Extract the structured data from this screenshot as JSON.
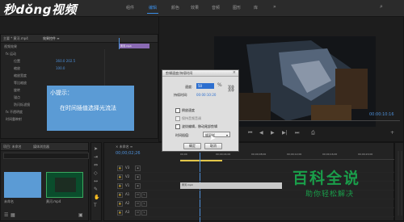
{
  "brand": {
    "text_left": "秒dǒng视频"
  },
  "top_tabs": [
    "组件",
    "编辑",
    "颜色",
    "效果",
    "音频",
    "图形",
    "库"
  ],
  "source_panel": {
    "tabs": [
      "主要 * 黄河.mp4",
      "效果控件 ≡",
      "源 * 黄河.mp4"
    ],
    "clip_name": "黄河.mp4",
    "rows": [
      {
        "label": "视频效果"
      },
      {
        "label": "fx 运动"
      },
      {
        "label": "位置",
        "value": "360.0  202.5"
      },
      {
        "label": "缩放",
        "value": "100.0"
      },
      {
        "label": "缩放宽度"
      },
      {
        "label": "等比缩放"
      },
      {
        "label": "旋转",
        "value": "0.0"
      },
      {
        "label": "锚点"
      },
      {
        "label": "防闪烁滤镜"
      },
      {
        "label": "fx 不透明度"
      },
      {
        "label": "时间重映射"
      }
    ]
  },
  "tip": {
    "title": "小提示：",
    "body": "在时间插值选择光流法"
  },
  "project": {
    "header": "项目: 未命名",
    "tab": "媒体浏览器",
    "search_hint": "",
    "items": [
      {
        "name": "未命名"
      },
      {
        "name": "黄河.mp4"
      }
    ]
  },
  "dialog": {
    "title": "剪辑速度/持续时间",
    "speed_label": "速度:",
    "speed_value": "50",
    "duration_label": "持续时间:",
    "duration_value": "00:00:10:20",
    "checks": [
      "倒放速度",
      "保持音频音调",
      "波纹编辑，移动尾部剪辑"
    ],
    "interp_label": "时间插值:",
    "interp_value": "帧采样",
    "ok": "确定",
    "cancel": "取消"
  },
  "program": {
    "timecode": "00:00:10:16"
  },
  "timeline": {
    "timecode": "00;00;02;26",
    "ruler_labels": [
      "00;00",
      "00;00;04;00",
      "00;00;08;00",
      "00;00;12;00",
      "00;00;16;00",
      "00;00;20;00"
    ],
    "video_tracks": [
      "V3",
      "V2",
      "V1"
    ],
    "audio_tracks": [
      "A1",
      "A2",
      "A3"
    ],
    "clip_label": "黄河.mp4"
  },
  "watermark": {
    "title": "百科全说",
    "subtitle": "助你轻松解决"
  }
}
